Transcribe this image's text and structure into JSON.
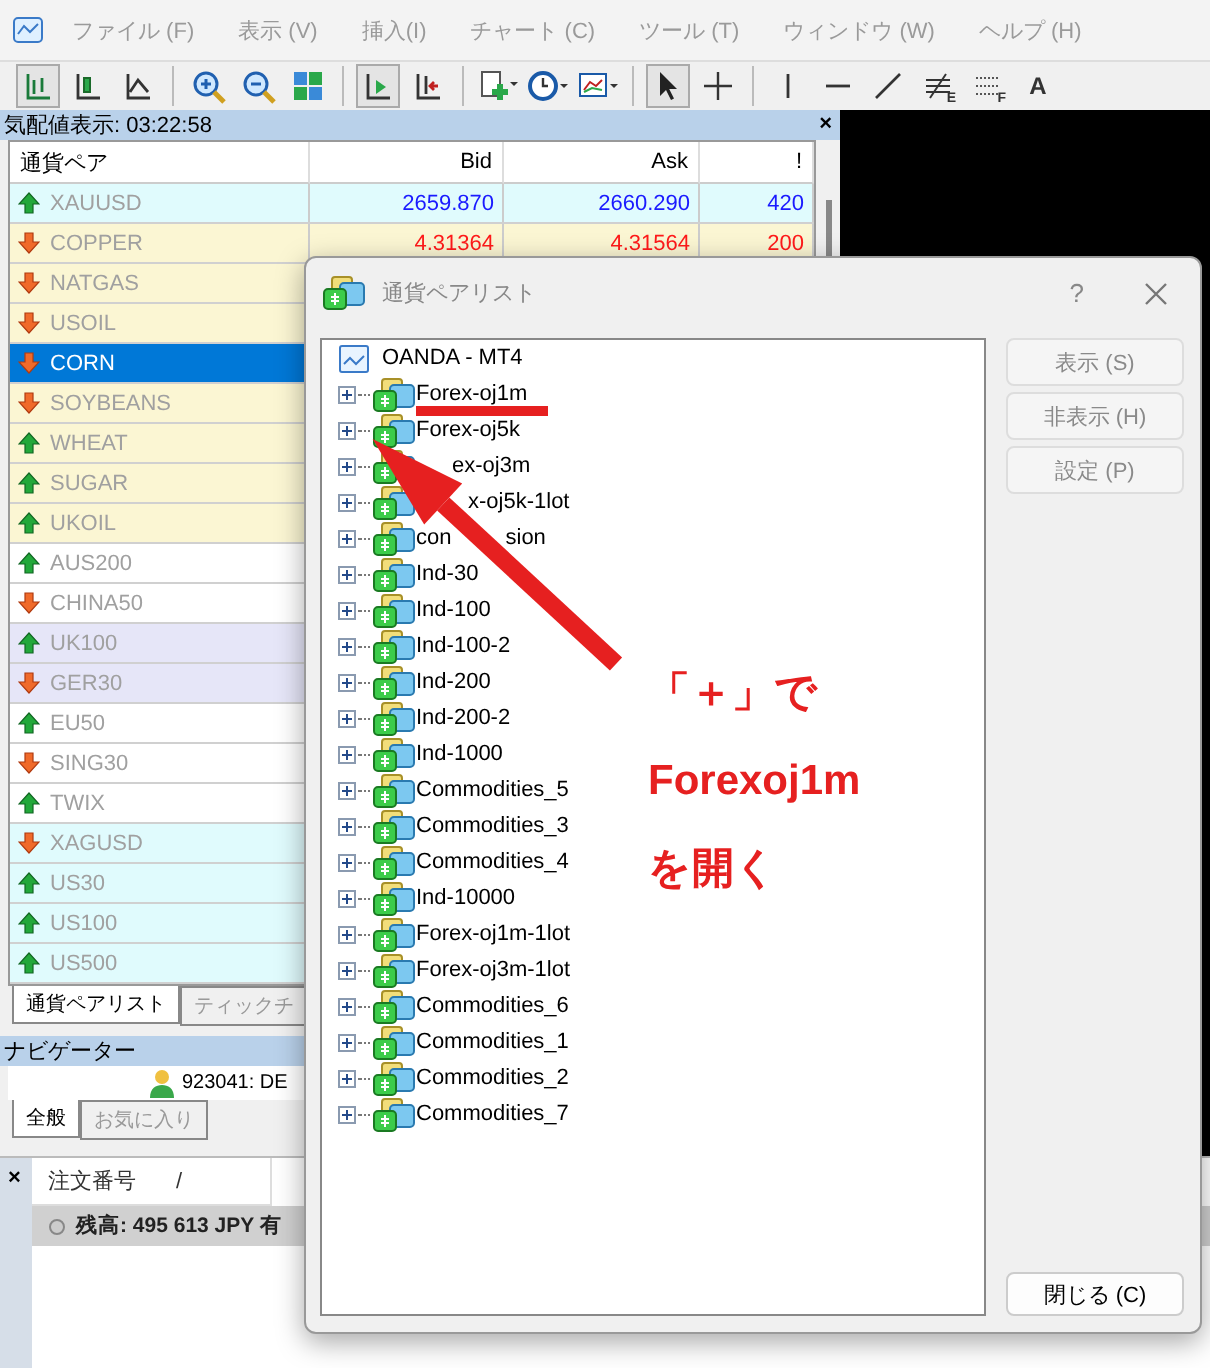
{
  "menu": [
    {
      "label": "ファイル (F)"
    },
    {
      "label": "表示 (V)"
    },
    {
      "label": "挿入(I)"
    },
    {
      "label": "チャート (C)"
    },
    {
      "label": "ツール (T)"
    },
    {
      "label": "ウィンドウ (W)"
    },
    {
      "label": "ヘルプ (H)"
    }
  ],
  "toolbar": [
    {
      "kind": "bars",
      "pressed": true
    },
    {
      "kind": "candles",
      "pressed": false
    },
    {
      "kind": "line",
      "pressed": false
    },
    {
      "kind": "sep"
    },
    {
      "kind": "zoom-in",
      "pressed": false
    },
    {
      "kind": "zoom-out",
      "pressed": false
    },
    {
      "kind": "tile",
      "pressed": false
    },
    {
      "kind": "sep"
    },
    {
      "kind": "autoscroll",
      "pressed": true
    },
    {
      "kind": "shift",
      "pressed": false
    },
    {
      "kind": "sep"
    },
    {
      "kind": "new-chart",
      "pressed": false
    },
    {
      "kind": "clock",
      "pressed": false
    },
    {
      "kind": "indicators",
      "pressed": false
    },
    {
      "kind": "sep"
    },
    {
      "kind": "cursor",
      "pressed": true
    },
    {
      "kind": "crosshair",
      "pressed": false
    },
    {
      "kind": "sep"
    },
    {
      "kind": "vline",
      "pressed": false
    },
    {
      "kind": "hline",
      "pressed": false
    },
    {
      "kind": "trend",
      "pressed": false
    },
    {
      "kind": "fibo",
      "pressed": false,
      "label": "E"
    },
    {
      "kind": "channel",
      "pressed": false,
      "label": "F"
    },
    {
      "kind": "text",
      "pressed": false,
      "label": "A"
    }
  ],
  "market_watch": {
    "title": "気配値表示: 03:22:58",
    "close": "×",
    "columns": [
      "通貨ペア",
      "Bid",
      "Ask",
      "!"
    ],
    "rows": [
      {
        "symbol": "XAUUSD",
        "kind": "up",
        "color": "#e0fbfd",
        "selected": false,
        "bid": "2659.870",
        "ask": "2660.290",
        "spread": "420"
      },
      {
        "symbol": "COPPER",
        "kind": "down",
        "color": "#fbf6d3",
        "selected": false,
        "bid": "4.31364",
        "ask": "4.31564",
        "spread": "200"
      },
      {
        "symbol": "NATGAS",
        "kind": "down",
        "color": "#fbf6d3",
        "selected": false
      },
      {
        "symbol": "USOIL",
        "kind": "down",
        "color": "#fbf6d3",
        "selected": false
      },
      {
        "symbol": "CORN",
        "kind": "down",
        "selected": true
      },
      {
        "symbol": "SOYBEANS",
        "kind": "down",
        "color": "#fbf6d3",
        "selected": false
      },
      {
        "symbol": "WHEAT",
        "kind": "up",
        "color": "#fbf6d3",
        "selected": false
      },
      {
        "symbol": "SUGAR",
        "kind": "up",
        "color": "#fbf6d3",
        "selected": false
      },
      {
        "symbol": "UKOIL",
        "kind": "up",
        "color": "#fbf6d3",
        "selected": false
      },
      {
        "symbol": "AUS200",
        "kind": "up",
        "color": "#ffffff",
        "selected": false
      },
      {
        "symbol": "CHINA50",
        "kind": "down",
        "color": "#ffffff",
        "selected": false
      },
      {
        "symbol": "UK100",
        "kind": "up",
        "color": "#e6e6f8",
        "selected": false
      },
      {
        "symbol": "GER30",
        "kind": "down",
        "color": "#e6e6f8",
        "selected": false
      },
      {
        "symbol": "EU50",
        "kind": "up",
        "color": "#ffffff",
        "selected": false
      },
      {
        "symbol": "SING30",
        "kind": "down",
        "color": "#ffffff",
        "selected": false
      },
      {
        "symbol": "TWIX",
        "kind": "up",
        "color": "#ffffff",
        "selected": false
      },
      {
        "symbol": "XAGUSD",
        "kind": "down",
        "color": "#e0fbfd",
        "selected": false
      },
      {
        "symbol": "US30",
        "kind": "up",
        "color": "#e0fbfd",
        "selected": false
      },
      {
        "symbol": "US100",
        "kind": "up",
        "color": "#e0fbfd",
        "selected": false
      },
      {
        "symbol": "US500",
        "kind": "up",
        "color": "#e0fbfd",
        "selected": false
      }
    ],
    "tabs": [
      {
        "label": "通貨ペアリスト",
        "selected": true
      },
      {
        "label": "ティックチ",
        "selected": false
      }
    ]
  },
  "navigator": {
    "title": "ナビゲーター",
    "account": "923041: DE",
    "tabs": [
      {
        "label": "全般",
        "selected": true
      },
      {
        "label": "お気に入り",
        "selected": false
      }
    ]
  },
  "terminal": {
    "close": "×",
    "columns": [
      "注文番号",
      "/"
    ],
    "balance": "残高: 495 613 JPY 有"
  },
  "dialog": {
    "title": "通貨ペアリスト",
    "help": "?",
    "tree": {
      "label": "OANDA - MT4",
      "children": [
        {
          "label": "Forex-oj1m",
          "expanded": false
        },
        {
          "label": "Forex-oj5k",
          "expanded": false
        },
        {
          "label": "ex-oj3m",
          "expanded": false
        },
        {
          "label": "x-oj5k-1lot",
          "expanded": false
        },
        {
          "label": "con",
          "label_after_arrow": "sion",
          "expanded": false
        },
        {
          "label": "Ind-30",
          "expanded": false
        },
        {
          "label": "Ind-100",
          "expanded": false
        },
        {
          "label": "Ind-100-2",
          "expanded": false
        },
        {
          "label": "Ind-200",
          "expanded": false
        },
        {
          "label": "Ind-200-2",
          "expanded": false
        },
        {
          "label": "Ind-1000",
          "expanded": false
        },
        {
          "label": "Commodities_5",
          "expanded": false
        },
        {
          "label": "Commodities_3",
          "expanded": false
        },
        {
          "label": "Commodities_4",
          "expanded": false
        },
        {
          "label": "Ind-10000",
          "expanded": false
        },
        {
          "label": "Forex-oj1m-1lot",
          "expanded": false
        },
        {
          "label": "Forex-oj3m-1lot",
          "expanded": false
        },
        {
          "label": "Commodities_6",
          "expanded": false
        },
        {
          "label": "Commodities_1",
          "expanded": false
        },
        {
          "label": "Commodities_2",
          "expanded": false
        },
        {
          "label": "Commodities_7",
          "expanded": false
        }
      ]
    },
    "side_buttons": [
      {
        "label": "表示 (S)",
        "disabled": true
      },
      {
        "label": "非表示 (H)",
        "disabled": true
      },
      {
        "label": "設定 (P)",
        "disabled": true
      }
    ],
    "close_button": "閉じる (C)"
  },
  "annotation": {
    "lines": [
      "「＋」で",
      "Forexoj1m",
      "を開く"
    ]
  }
}
